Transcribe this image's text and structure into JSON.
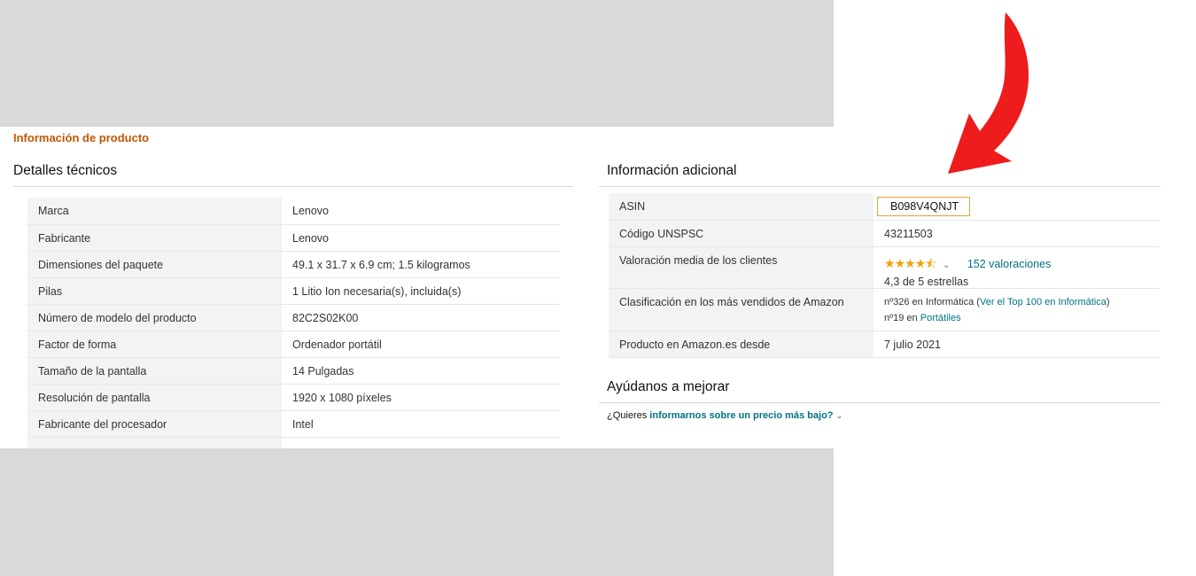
{
  "section_title": "Información de producto",
  "technical": {
    "heading": "Detalles técnicos",
    "rows": [
      {
        "label": "Marca",
        "value": "Lenovo"
      },
      {
        "label": "Fabricante",
        "value": "Lenovo"
      },
      {
        "label": "Dimensiones del paquete",
        "value": "49.1 x 31.7 x 6.9 cm; 1.5 kilogramos"
      },
      {
        "label": "Pilas",
        "value": "1 Litio Ion necesaria(s), incluida(s)"
      },
      {
        "label": "Número de modelo del producto",
        "value": "82C2S02K00"
      },
      {
        "label": "Factor de forma",
        "value": "Ordenador portátil"
      },
      {
        "label": "Tamaño de la pantalla",
        "value": "14 Pulgadas"
      },
      {
        "label": "Resolución de pantalla",
        "value": "1920 x 1080 píxeles"
      },
      {
        "label": "Fabricante del procesador",
        "value": "Intel"
      }
    ]
  },
  "additional": {
    "heading": "Información adicional",
    "asin_label": "ASIN",
    "asin_value": "B098V4QNJT",
    "unspsc_label": "Código UNSPSC",
    "unspsc_value": "43211503",
    "rating_label": "Valoración media de los clientes",
    "rating_stars": "★★★★⯪",
    "rating_reviews": "152 valoraciones",
    "rating_text": "4,3 de 5 estrellas",
    "rating_value": 4.3,
    "ranking_label": "Clasificación en los más vendidos de Amazon",
    "rank1_prefix": "nº326 en Informática (",
    "rank1_link": "Ver el Top 100 en Informática",
    "rank1_suffix": ")",
    "rank2_prefix": "nº19 en ",
    "rank2_link": "Portátiles",
    "since_label": "Producto en Amazon.es desde",
    "since_value": "7 julio 2021"
  },
  "help": {
    "heading": "Ayúdanos a mejorar",
    "question_prefix": "¿Quieres ",
    "question_link": "informarnos sobre un precio más bajo?"
  },
  "colors": {
    "accent_orange": "#c45500",
    "link_teal": "#007185",
    "star": "#f49e0b",
    "arrow_red": "#ee1c1c",
    "mask_gray": "#d9d9d9"
  }
}
